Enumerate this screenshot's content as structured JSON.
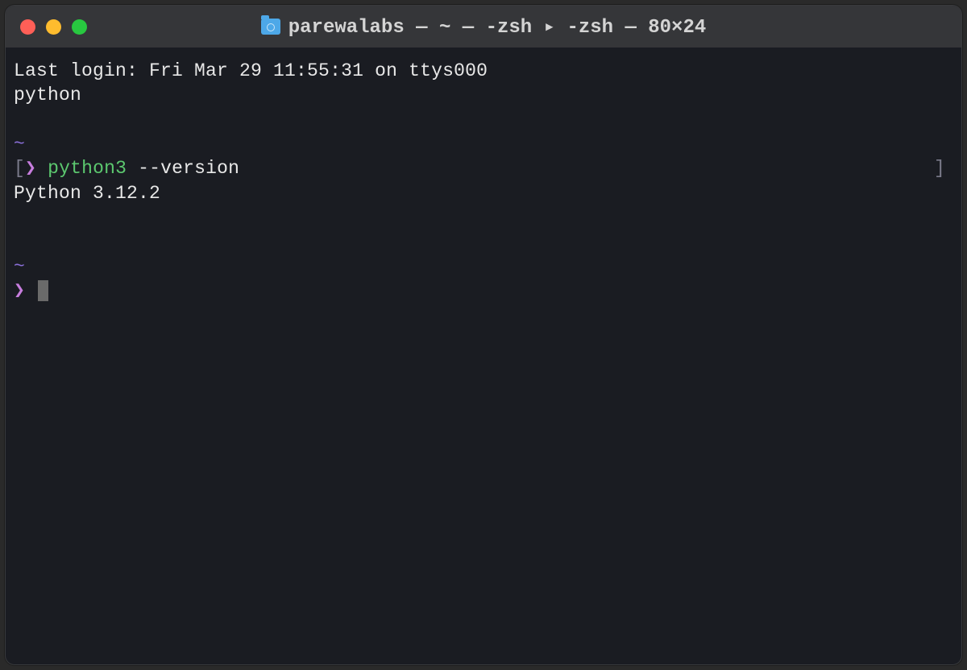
{
  "titlebar": {
    "title": "parewalabs — ~ — -zsh ▸ -zsh — 80×24"
  },
  "terminal": {
    "last_login_line": "Last login: Fri Mar 29 11:55:31 on ttys000",
    "line2": "python",
    "tilde1": "~",
    "prompt1_open": "[",
    "prompt1_arrow": "❯",
    "prompt1_command": "python3",
    "prompt1_args": " --version",
    "prompt1_close": "]",
    "output1": "Python 3.12.2",
    "tilde2": "~",
    "prompt2_arrow": "❯"
  }
}
